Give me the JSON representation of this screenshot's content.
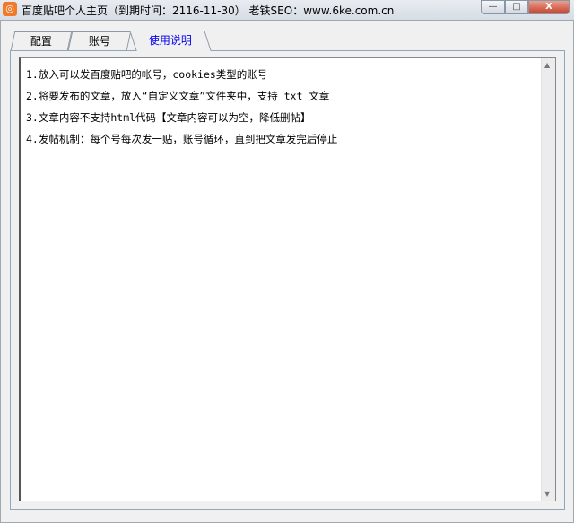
{
  "window": {
    "title": "百度贴吧个人主页（到期时间：2116-11-30） 老铁SEO：www.6ke.com.cn",
    "minimize": "—",
    "maximize": "□",
    "close": "X"
  },
  "tabs": [
    {
      "label": "配置"
    },
    {
      "label": "账号"
    },
    {
      "label": "使用说明",
      "active": true
    }
  ],
  "content": {
    "lines": [
      "1.放入可以发百度贴吧的帐号，cookies类型的账号",
      "2.将要发布的文章，放入“自定义文章”文件夹中，支持 txt 文章",
      "3.文章内容不支持html代码【文章内容可以为空，降低删帖】",
      "4.发帖机制：每个号每次发一贴，账号循环，直到把文章发完后停止"
    ]
  },
  "colors": {
    "active_tab": "#0000ee",
    "close": "#c8412b"
  }
}
